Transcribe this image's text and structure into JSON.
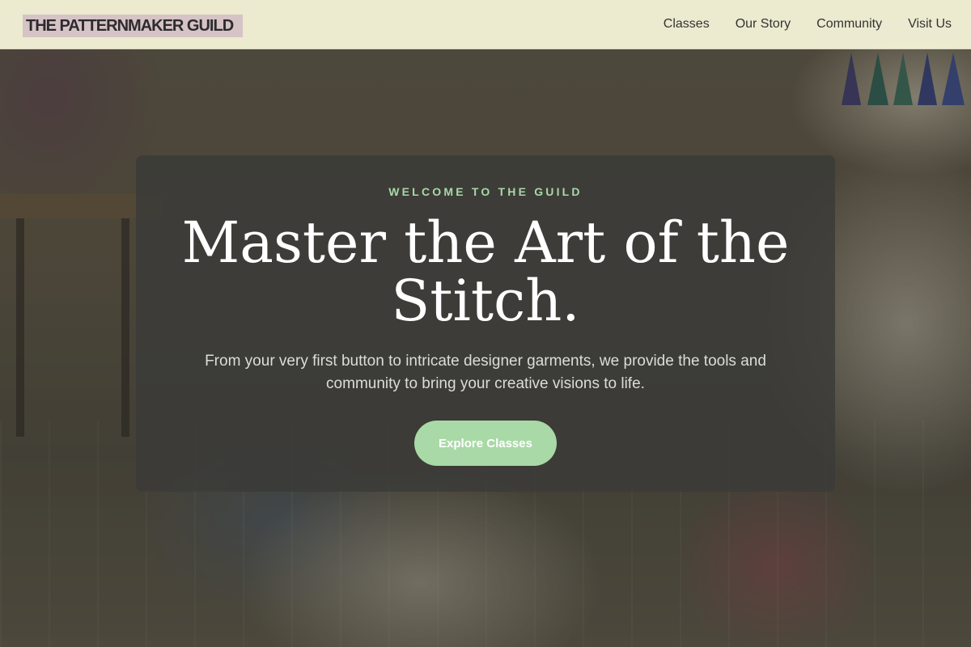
{
  "header": {
    "brand": "THE PATTERNMAKER GUILD",
    "nav": [
      {
        "label": "Classes"
      },
      {
        "label": "Our Story"
      },
      {
        "label": "Community"
      },
      {
        "label": "Visit Us"
      }
    ]
  },
  "hero": {
    "eyebrow": "WELCOME TO THE GUILD",
    "title": "Master the Art of the Stitch.",
    "subtitle": "From your very first button to intricate designer garments, we provide the tools and community to bring your creative visions to life.",
    "cta_label": "Explore Classes"
  },
  "colors": {
    "header_bg": "#f3f1d6",
    "brand_highlight": "#dcc9cc",
    "accent_green": "#a9d9a6",
    "card_bg": "#3a3a38"
  }
}
